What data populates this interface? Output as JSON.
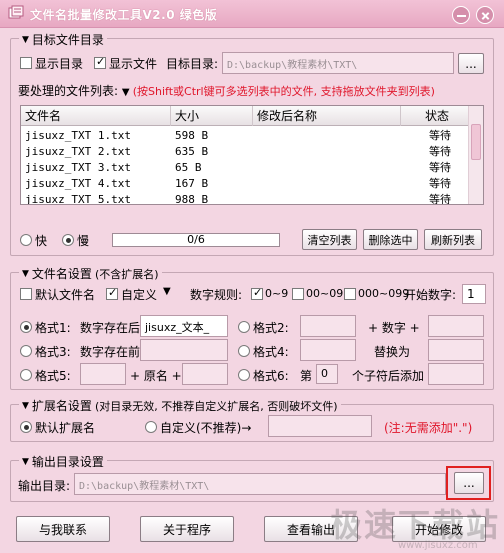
{
  "window": {
    "title": "文件名批量修改工具V2.0  绿色版"
  },
  "target_group": {
    "legend": "目标文件目录",
    "show_dir_label": "显示目录",
    "show_dir_checked": false,
    "show_file_label": "显示文件",
    "show_file_checked": true,
    "target_dir_label": "目标目录:",
    "target_dir_value": "D:\\backup\\教程素材\\TXT\\",
    "browse_label": "...",
    "list_label": "要处理的文件列表:",
    "list_hint": "(按Shift或Ctrl键可多选列表中的文件, 支持拖放文件夹到列表)",
    "columns": [
      "文件名",
      "大小",
      "修改后名称",
      "状态"
    ],
    "rows": [
      {
        "name": "jisuxz_TXT 1.txt",
        "size": "598 B",
        "new_name": "",
        "status": "等待"
      },
      {
        "name": "jisuxz_TXT 2.txt",
        "size": "635 B",
        "new_name": "",
        "status": "等待"
      },
      {
        "name": "jisuxz_TXT 3.txt",
        "size": "65 B",
        "new_name": "",
        "status": "等待"
      },
      {
        "name": "jisuxz_TXT 4.txt",
        "size": "167 B",
        "new_name": "",
        "status": "等待"
      },
      {
        "name": "jisuxz_TXT 5.txt",
        "size": "988 B",
        "new_name": "",
        "status": "等待"
      }
    ],
    "speed_fast_label": "快",
    "speed_slow_label": "慢",
    "speed_selected": "slow",
    "progress_text": "0/6",
    "progress_fraction": 0.0,
    "clear_button": "清空列表",
    "delete_button": "删除选中",
    "refresh_button": "刷新列表"
  },
  "name_group": {
    "legend": "文件名设置",
    "legend_note": "(不含扩展名)",
    "default_name_label": "默认文件名",
    "default_name_checked": false,
    "custom_label": "自定义",
    "custom_checked": true,
    "number_rule_label": "数字规则:",
    "rule1_label": "0~9",
    "rule1_checked": true,
    "rule2_label": "00~09",
    "rule2_checked": false,
    "rule3_label": "000~099",
    "rule3_checked": false,
    "start_number_label": "开始数字:",
    "start_number_value": "1",
    "format1_label": "格式1:",
    "format1_text": "数字存在后:",
    "format1_value": "jisuxz_文本_",
    "format2_label": "格式2:",
    "format2_plus": "+ 数字 +",
    "format3_label": "格式3:",
    "format3_text": "数字存在前:",
    "format4_label": "格式4:",
    "format4_replace": "替换为",
    "format5_label": "格式5:",
    "format5_plus1": "+ 原名 +",
    "format6_label": "格式6:",
    "format6_pre": "第",
    "format6_value": "0",
    "format6_post": "个子符后添加",
    "format_selected": "format1"
  },
  "ext_group": {
    "legend": "扩展名设置",
    "legend_note": "(对目录无效, 不推荐自定义扩展名, 否则破坏文件)",
    "default_ext_label": "默认扩展名",
    "custom_ext_label": "自定义(不推荐)→",
    "ext_selected": "default",
    "note": "(注:无需添加\".\")"
  },
  "output_group": {
    "legend": "输出目录设置",
    "output_label": "输出目录:",
    "output_value": "D:\\backup\\教程素材\\TXT\\",
    "browse_label": "..."
  },
  "footer": {
    "contact_button": "与我联系",
    "about_button": "关于程序",
    "view_output_button": "查看输出",
    "start_button": "开始修改"
  },
  "watermark": {
    "text": "极速下载站",
    "url": "www.jisuxz.com"
  },
  "colors": {
    "background": "#f3d6e2",
    "accent_red": "#e0162b",
    "highlight_red": "#e0201f"
  }
}
